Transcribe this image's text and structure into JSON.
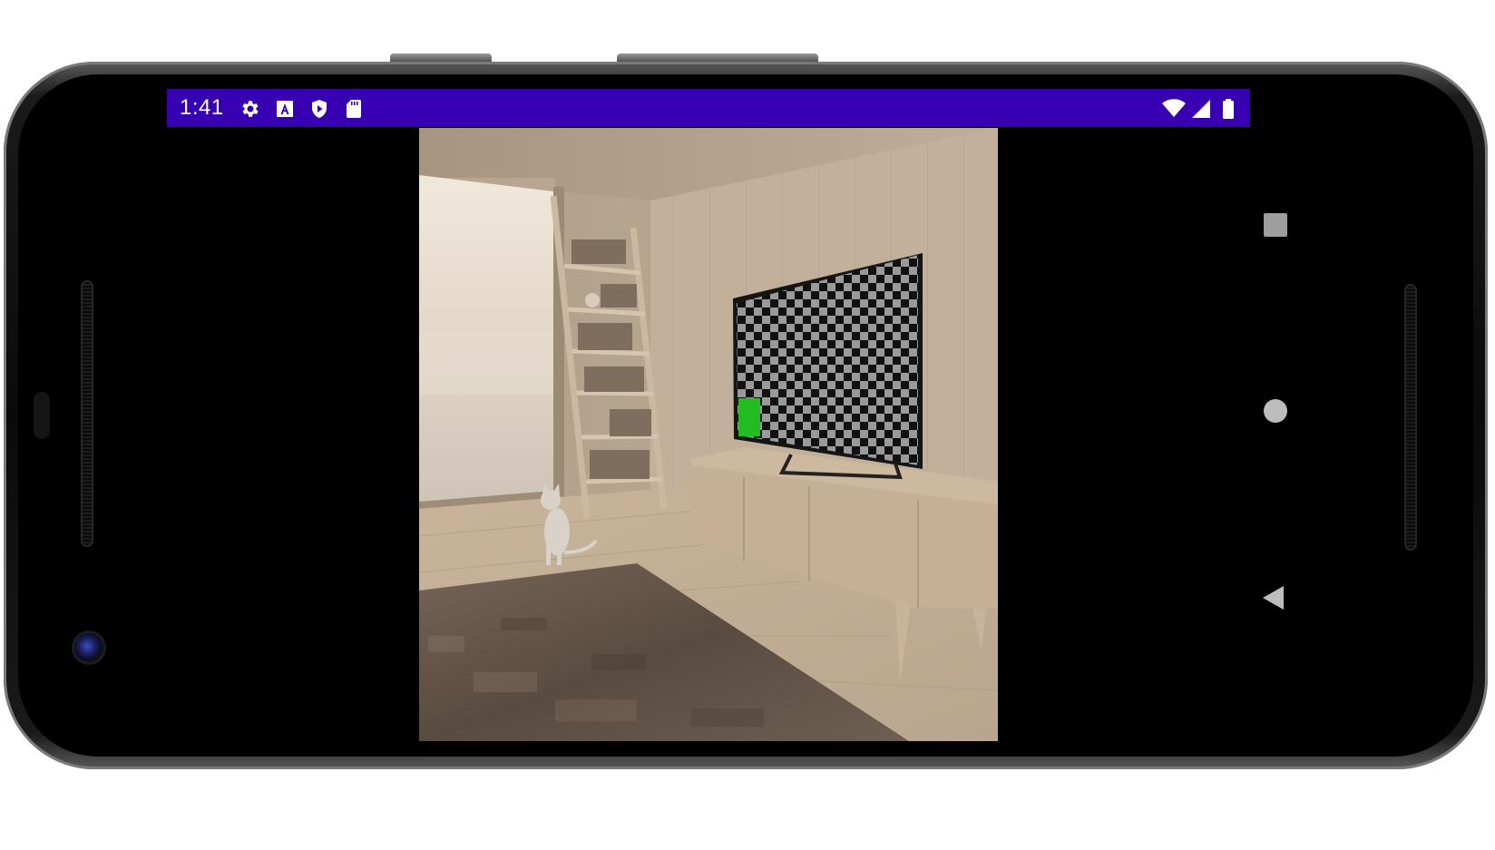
{
  "status_bar": {
    "time": "1:41",
    "notification_icons": [
      "settings-icon",
      "text-a-icon",
      "shield-play-icon",
      "sd-card-icon"
    ],
    "system_icons": [
      "wifi-icon",
      "cell-signal-icon",
      "battery-icon"
    ],
    "background_color": "#3700b3"
  },
  "content": {
    "scene": "3d-room-render",
    "tv_screen": "checkerboard-pattern",
    "marker_color": "#22bb22"
  },
  "nav_bar": {
    "buttons": [
      "recents-button",
      "home-button",
      "back-button"
    ]
  }
}
